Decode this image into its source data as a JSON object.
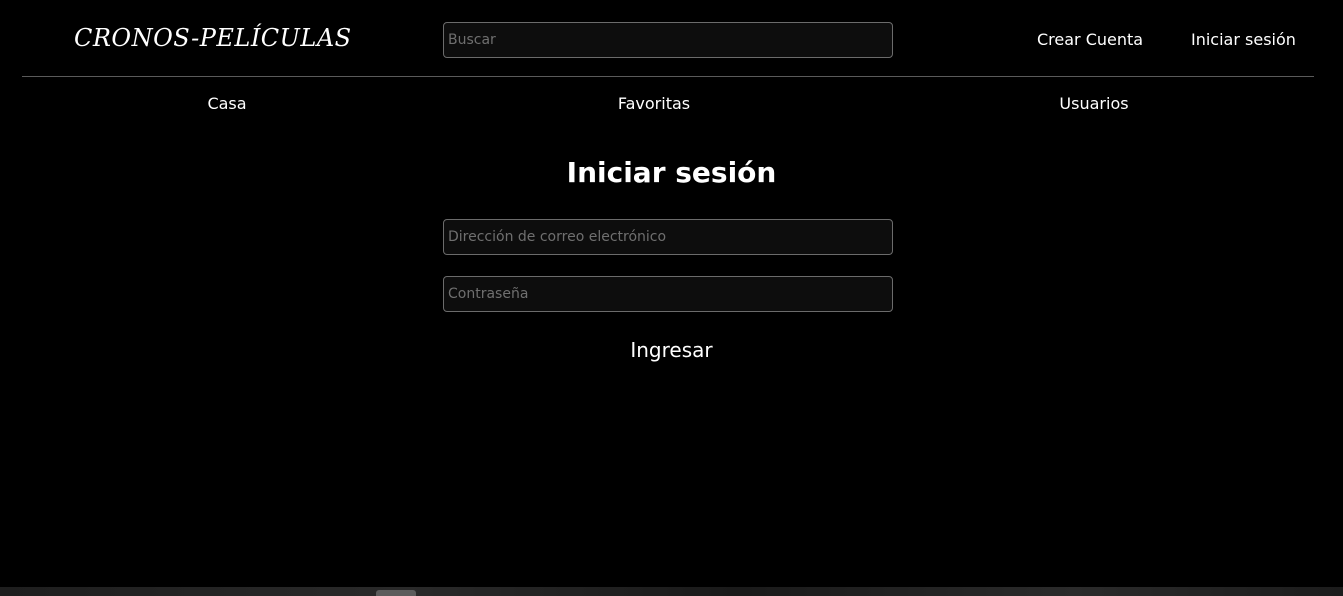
{
  "header": {
    "logo": "CRONOS-PELÍCULAS",
    "search_placeholder": "Buscar",
    "create_account_label": "Crear Cuenta",
    "login_label": "Iniciar sesión"
  },
  "nav": {
    "items": [
      {
        "label": "Casa"
      },
      {
        "label": "Favoritas"
      },
      {
        "label": "Usuarios"
      }
    ]
  },
  "login_form": {
    "title": "Iniciar sesión",
    "email_placeholder": "Dirección de correo electrónico",
    "password_placeholder": "Contraseña",
    "submit_label": "Ingresar"
  },
  "colors": {
    "background": "#000000",
    "text": "#ffffff",
    "input_border": "#6b6b6b",
    "divider": "#5a5a5a"
  }
}
